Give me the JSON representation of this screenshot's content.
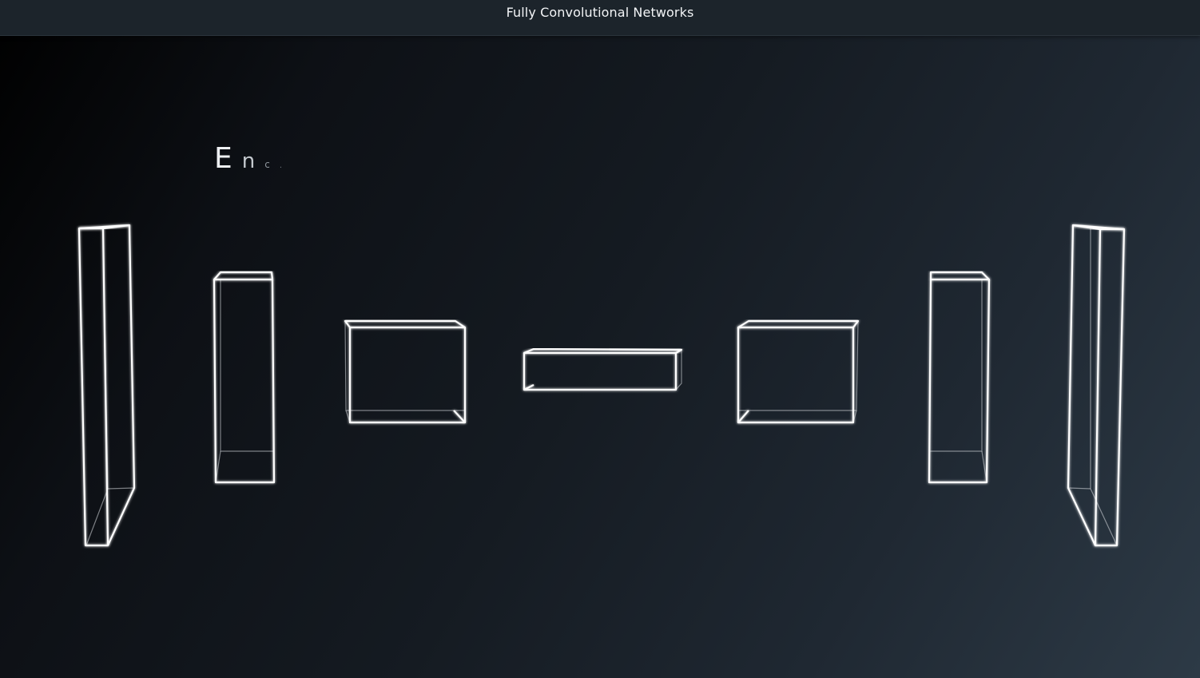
{
  "window": {
    "title": "Fully Convolutional Networks"
  },
  "scene": {
    "caption_chars": [
      "E",
      "n",
      "c",
      "."
    ],
    "layer_count": 7,
    "edge_color": "#ffffff",
    "background_colors": [
      "#000000",
      "#151b22",
      "#2d3a46"
    ]
  }
}
